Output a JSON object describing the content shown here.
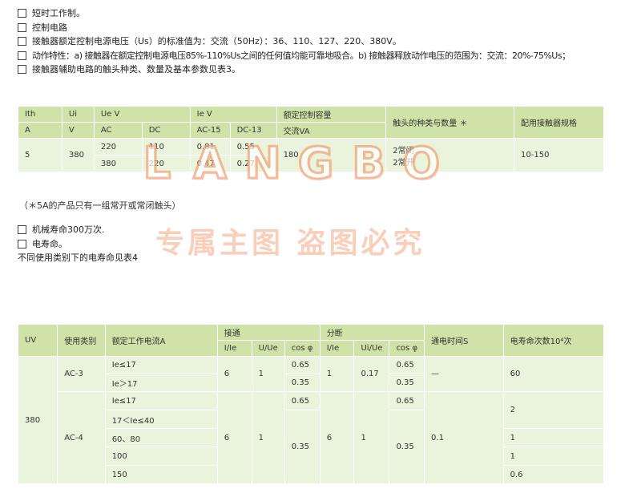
{
  "bullets_top": [
    "短时工作制。",
    "控制电路",
    "接触器额定控制电源电压（Us）的标准值为：交流（50Hz）：36、110、127、220、380V。",
    "动作特性：a) 接触器在额定控制电源电压85%-110%Us之间的任何值均能可靠地吸合。b) 接触器释放动作电压的范围为：交流：20%-75%Us；",
    "接触器辅助电路的触头种类、数量及基本参数见表3。"
  ],
  "table1": {
    "h_ith": "Ith",
    "h_a": "A",
    "h_ui": "Ui",
    "h_v": "V",
    "h_ue": "Ue V",
    "h_ie": "Ie V",
    "h_cap": "额定控制容量",
    "h_contact": "触头的种类与数量 ＊",
    "h_model": "配用接触器规格",
    "h_ac": "AC",
    "h_dc": "DC",
    "h_ac15": "AC-15",
    "h_dc13": "DC-13",
    "h_va": "交流VA",
    "ith": "5",
    "ui": "380",
    "r1_ac": "220",
    "r1_dc": "110",
    "r1_ac15": "0.81",
    "r1_dc13": "0.55",
    "r2_ac": "380",
    "r2_dc": "220",
    "r2_ac15": "0.47",
    "r2_dc13": "0.27",
    "va": "180",
    "contact1": "2常闭",
    "contact2": "2常开",
    "model": "10-150"
  },
  "note": "（＊5A的产品只有一组常开或常闭触头）",
  "bullets_mid": [
    "机械寿命300万次.",
    "电寿命。"
  ],
  "plain_mid": "不同使用类别下的电寿命见表4",
  "table2": {
    "h_uv": "UV",
    "h_cat": "使用类别",
    "h_cur": "额定工作电流A",
    "h_make": "接通",
    "h_break": "分断",
    "h_time": "通电时间S",
    "h_life": "电寿命次数10⁴次",
    "h_i_ie": "I/Ie",
    "h_u_ue": "U/Ue",
    "h_cos": "cos φ",
    "h_i_ie2": "I/Ie",
    "h_ui_ue": "Ui/Ue",
    "h_cos2": "cos φ",
    "uv": "380",
    "ac3": "AC-3",
    "ac4": "AC-4",
    "ac3_c1": "Ie≤17",
    "ac3_c2": "Ie＞17",
    "ac3_make_i": "6",
    "ac3_make_u": "1",
    "ac3_cos1": "0.65",
    "ac3_cos2": "0.35",
    "ac3_break_i": "1",
    "ac3_break_u": "0.17",
    "ac3_bcos1": "0.65",
    "ac3_bcos2": "0.35",
    "ac3_time": "—",
    "ac3_life": "60",
    "ac4_c1": "Ie≤17",
    "ac4_c2": "17＜Ie≤40",
    "ac4_c3": "60、80",
    "ac4_c4": "100",
    "ac4_c5": "150",
    "ac4_make_i": "6",
    "ac4_make_u": "1",
    "ac4_cos1": "0.65",
    "ac4_cos2": "0.35",
    "ac4_break_i": "6",
    "ac4_break_u": "1",
    "ac4_bcos1": "0.65",
    "ac4_bcos2": "0.35",
    "ac4_time": "0.1",
    "ac4_life1": "2",
    "ac4_life2": "1",
    "ac4_life3": "1",
    "ac4_life4": "0.6"
  },
  "watermark": {
    "letters": [
      "L",
      "A",
      "N",
      "G",
      "B",
      "O"
    ],
    "text": "专属主图  盗图必究"
  },
  "colors": {
    "header_green": "#cfe3a8",
    "row_green": "#eaf3db",
    "watermark_orange": "#f0a277",
    "accent_red": "#c0392b"
  }
}
